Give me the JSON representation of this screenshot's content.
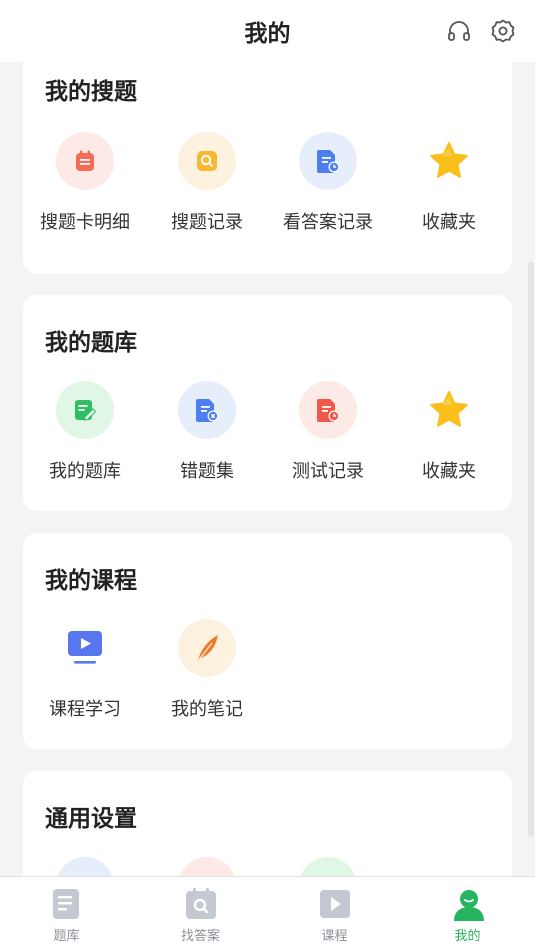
{
  "header": {
    "title": "我的",
    "headset_icon": "headset-icon",
    "settings_icon": "gear-icon"
  },
  "sections": [
    {
      "title": "我的搜题",
      "items": [
        {
          "label": "搜题卡明细",
          "icon": "card-detail-icon",
          "bg": "#fde9e6"
        },
        {
          "label": "搜题记录",
          "icon": "search-record-icon",
          "bg": "#fdf1df"
        },
        {
          "label": "看答案记录",
          "icon": "answer-record-icon",
          "bg": "#e6edfb"
        },
        {
          "label": "收藏夹",
          "icon": "star-icon",
          "bg": "#ffffff"
        }
      ]
    },
    {
      "title": "我的题库",
      "items": [
        {
          "label": "我的题库",
          "icon": "question-bank-icon",
          "bg": "#e1f7e6"
        },
        {
          "label": "错题集",
          "icon": "wrong-questions-icon",
          "bg": "#e6edfb"
        },
        {
          "label": "测试记录",
          "icon": "test-record-icon",
          "bg": "#fde9e6"
        },
        {
          "label": "收藏夹",
          "icon": "star-icon",
          "bg": "#ffffff"
        }
      ]
    },
    {
      "title": "我的课程",
      "items": [
        {
          "label": "课程学习",
          "icon": "course-play-icon",
          "bg": "#ffffff"
        },
        {
          "label": "我的笔记",
          "icon": "feather-pen-icon",
          "bg": "#fdf1df"
        }
      ]
    },
    {
      "title": "通用设置",
      "items": [
        {
          "label": "",
          "icon": "setting-blue-icon",
          "bg": "#e6edfb"
        },
        {
          "label": "",
          "icon": "setting-red-icon",
          "bg": "#fde9e6"
        },
        {
          "label": "",
          "icon": "setting-green-icon",
          "bg": "#e1f7e6"
        }
      ]
    }
  ],
  "tabs": [
    {
      "label": "题库",
      "icon": "question-bank-tab-icon",
      "active": false
    },
    {
      "label": "找答案",
      "icon": "find-answer-tab-icon",
      "active": false
    },
    {
      "label": "课程",
      "icon": "course-tab-icon",
      "active": false
    },
    {
      "label": "我的",
      "icon": "profile-tab-icon",
      "active": true
    }
  ],
  "colors": {
    "accent": "#26b55f",
    "inactive": "#8a9099",
    "background": "#f3f4f6"
  }
}
